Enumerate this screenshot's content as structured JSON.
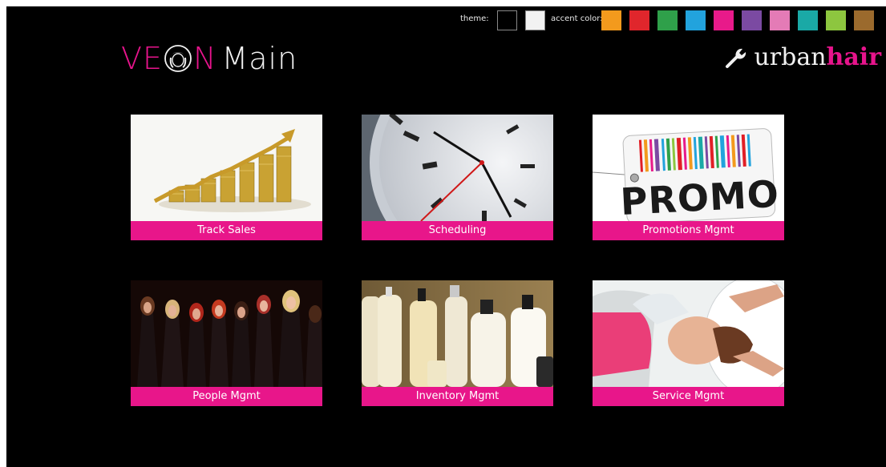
{
  "settings": {
    "theme_label": "theme:",
    "accent_label": "accent color:",
    "theme_colors": [
      "#000000",
      "#f2f2f2"
    ],
    "accent_colors": [
      "#f39a1d",
      "#e0262c",
      "#2fa04a",
      "#22a3dd",
      "#e81a8a",
      "#7b4aa2",
      "#e47bb6",
      "#1aa9a6",
      "#8dc63f",
      "#9b6a2d"
    ]
  },
  "header": {
    "title_pre": "VE",
    "title_post": "N",
    "title_main": "Main",
    "brand_urban": "urban",
    "brand_hair": "hair",
    "logo_icon": "wrench-icon"
  },
  "colors": {
    "accent": "#e8168a",
    "background": "#000000"
  },
  "tiles": [
    {
      "label": "Track Sales",
      "icon": "coins-growth-image"
    },
    {
      "label": "Scheduling",
      "icon": "clock-image"
    },
    {
      "label": "Promotions Mgmt",
      "icon": "promo-tag-image"
    },
    {
      "label": "People Mgmt",
      "icon": "stylists-group-image"
    },
    {
      "label": "Inventory Mgmt",
      "icon": "product-bottles-image"
    },
    {
      "label": "Service Mgmt",
      "icon": "hair-wash-image"
    }
  ]
}
